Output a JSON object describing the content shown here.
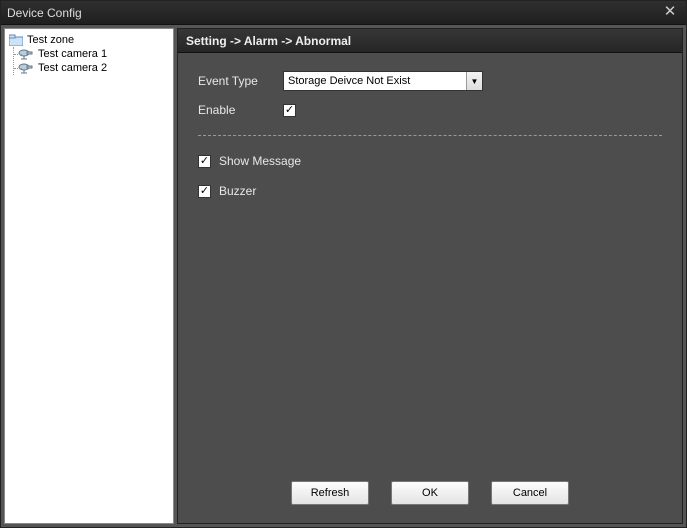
{
  "window": {
    "title": "Device Config",
    "close_glyph": "✕"
  },
  "sidebar": {
    "root": "Test zone",
    "items": [
      {
        "label": "Test camera 1"
      },
      {
        "label": "Test camera 2"
      }
    ]
  },
  "breadcrumb": "Setting -> Alarm -> Abnormal",
  "form": {
    "event_type_label": "Event Type",
    "event_type_value": "Storage Deivce Not Exist",
    "enable_label": "Enable",
    "enable_checked": "✓",
    "show_message_label": "Show Message",
    "show_message_checked": "✓",
    "buzzer_label": "Buzzer",
    "buzzer_checked": "✓"
  },
  "buttons": {
    "refresh": "Refresh",
    "ok": "OK",
    "cancel": "Cancel"
  }
}
